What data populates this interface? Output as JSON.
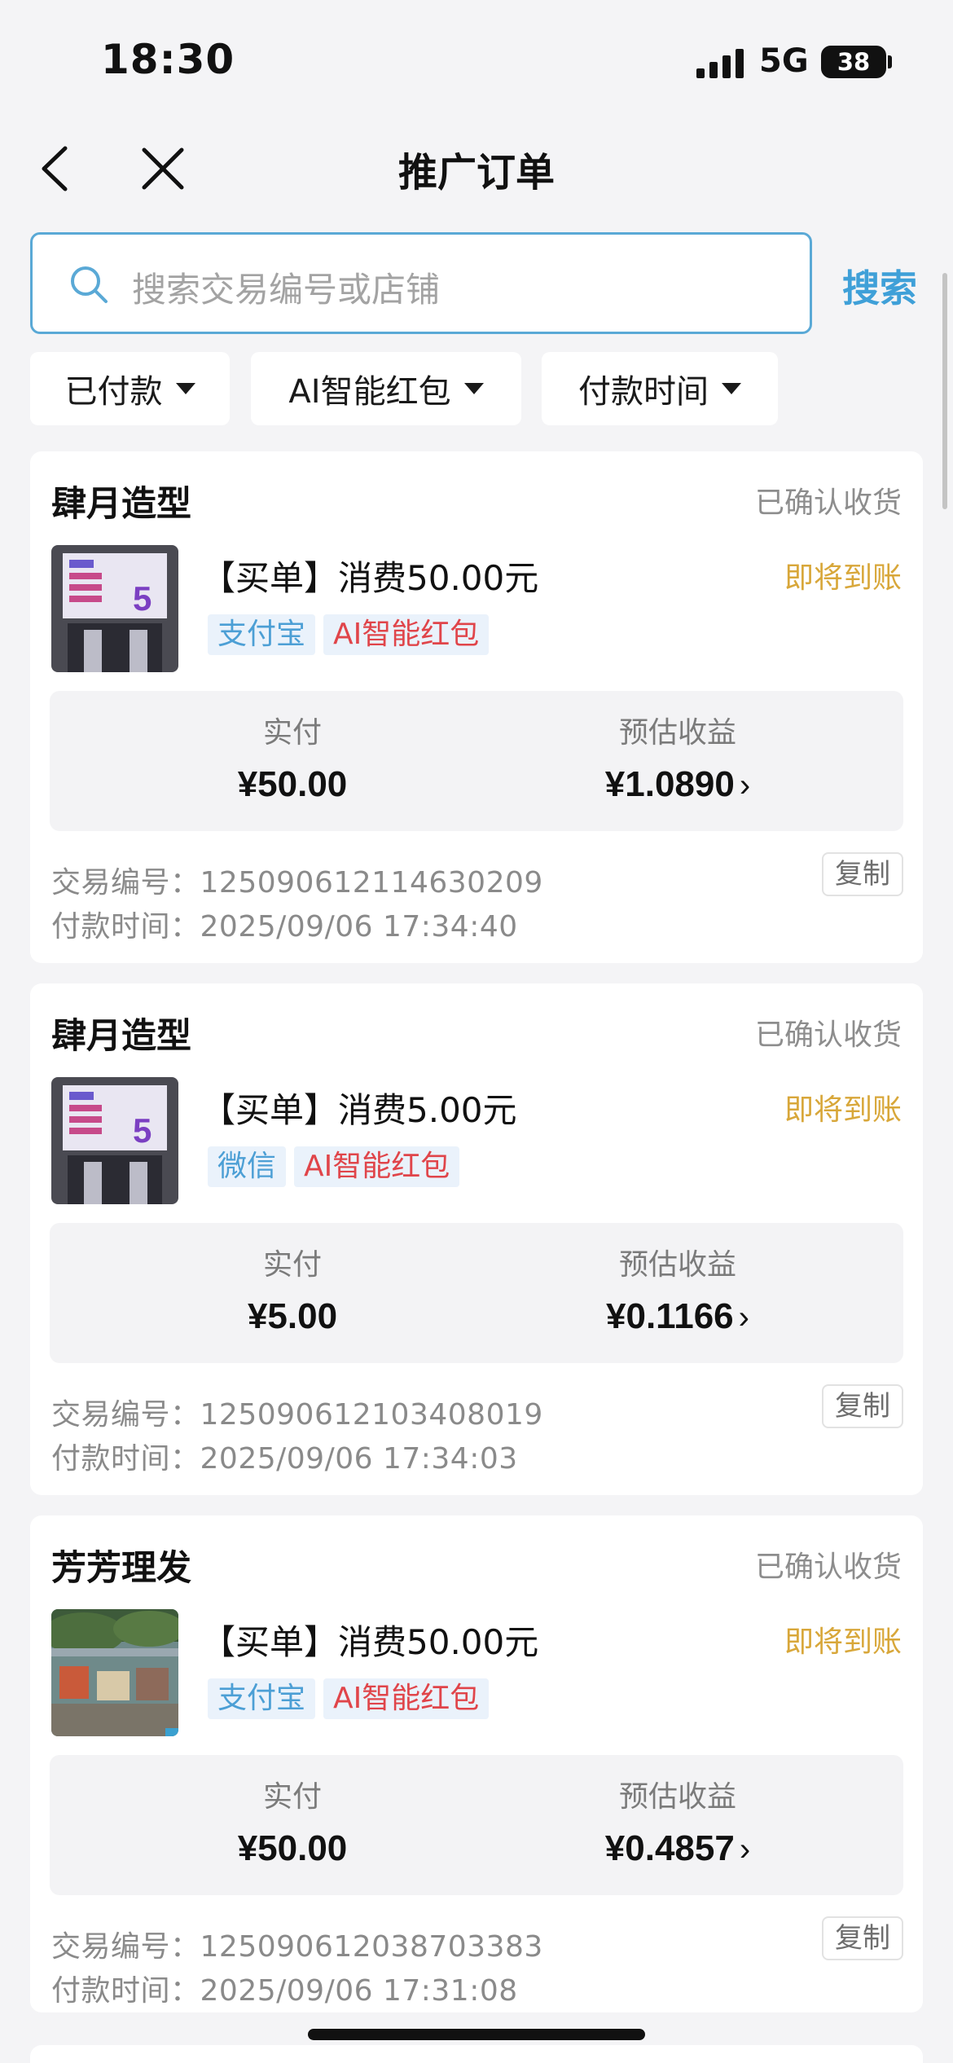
{
  "status_bar": {
    "time": "18:30",
    "network": "5G",
    "battery": "38"
  },
  "nav": {
    "title": "推广订单"
  },
  "search": {
    "placeholder": "搜索交易编号或店铺",
    "button": "搜索"
  },
  "filters": [
    {
      "label": "已付款"
    },
    {
      "label": "AI智能红包"
    },
    {
      "label": "付款时间"
    }
  ],
  "labels": {
    "paid": "实付",
    "estimated_income": "预估收益",
    "tx_no": "交易编号：",
    "pay_time": "付款时间：",
    "copy": "复制"
  },
  "orders": [
    {
      "shop": "肆月造型",
      "status": "已确认收货",
      "title": "【买单】消费50.00元",
      "settle": "即将到账",
      "tags": [
        "支付宝",
        "AI智能红包"
      ],
      "paid": "¥50.00",
      "income": "¥1.0890",
      "tx_no": "125090612114630209",
      "pay_time": "2025/09/06 17:34:40"
    },
    {
      "shop": "肆月造型",
      "status": "已确认收货",
      "title": "【买单】消费5.00元",
      "settle": "即将到账",
      "tags": [
        "微信",
        "AI智能红包"
      ],
      "paid": "¥5.00",
      "income": "¥0.1166",
      "tx_no": "125090612103408019",
      "pay_time": "2025/09/06 17:34:03"
    },
    {
      "shop": "芳芳理发",
      "status": "已确认收货",
      "title": "【买单】消费50.00元",
      "settle": "即将到账",
      "tags": [
        "支付宝",
        "AI智能红包"
      ],
      "paid": "¥50.00",
      "income": "¥0.4857",
      "tx_no": "125090612038703383",
      "pay_time": "2025/09/06 17:31:08"
    }
  ],
  "thumbnail_text": {
    "shop_sign_number": "5"
  },
  "colors": {
    "accent_blue": "#3fa0d8",
    "settle_gold": "#d8a73a",
    "tag_red": "#e0454a",
    "tag_bg": "#eaf2fb"
  }
}
